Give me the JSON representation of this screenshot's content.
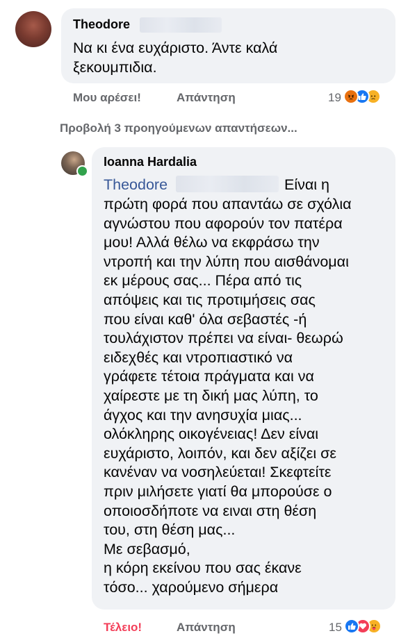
{
  "comment1": {
    "author": "Theodore",
    "text_lines": [
      "Να κι ένα ευχάριστο. Άντε καλά",
      "ξεκουμπιδια."
    ],
    "like_label": "Μου αρέσει!",
    "reply_label": "Απάντηση",
    "reaction_count": "19",
    "reactions": [
      "angry-icon",
      "like-icon",
      "sad-icon"
    ]
  },
  "view_previous_replies": "Προβολή 3 προηγούμενων απαντήσεων...",
  "comment2": {
    "author": "Ioanna Hardalia",
    "mention": "Theodore",
    "first_line_rest": "Είναι η",
    "text_lines": [
      "πρώτη φορά που απαντάω σε σχόλια",
      "αγνώστου που αφορούν τον πατέρα",
      "μου! Αλλά θέλω να εκφράσω την",
      "ντροπή και την λύπη που αισθάνομαι",
      "εκ μέρους σας... Πέρα από τις",
      "απόψεις και τις προτιμήσεις σας",
      "που είναι καθ' όλα σεβαστές -ή",
      "τουλάχιστον πρέπει να είναι- θεωρώ",
      "ειδεχθές και ντροπιαστικό να",
      "γράφετε τέτοια πράγματα και να",
      "χαίρεστε με τη δική μας λύπη, το",
      "άγχος και την ανησυχία μιας...",
      "ολόκληρης οικογένειας! Δεν είναι",
      "ευχάριστο, λοιπόν, και δεν αξίζει σε",
      "κανέναν να νοσηλεύεται! Σκεφτείτε",
      "πριν μιλήσετε γιατί θα μπορούσε ο",
      "οποιοσδήποτε να ειναι στη θέση",
      "του, στη θέση μας...",
      "Με σεβασμό,",
      "η κόρη εκείνου που σας έκανε",
      "τόσο... χαρούμενο σήμερα"
    ],
    "like_label": "Τέλειο!",
    "reply_label": "Απάντηση",
    "reaction_count": "15",
    "reactions": [
      "like-icon",
      "love-icon",
      "care-icon"
    ]
  },
  "colors": {
    "bubble": "#f0f2f5",
    "meta_text": "#65676b",
    "love_reaction_label": "#f33e58",
    "mention": "#385898",
    "online": "#31a24c"
  }
}
